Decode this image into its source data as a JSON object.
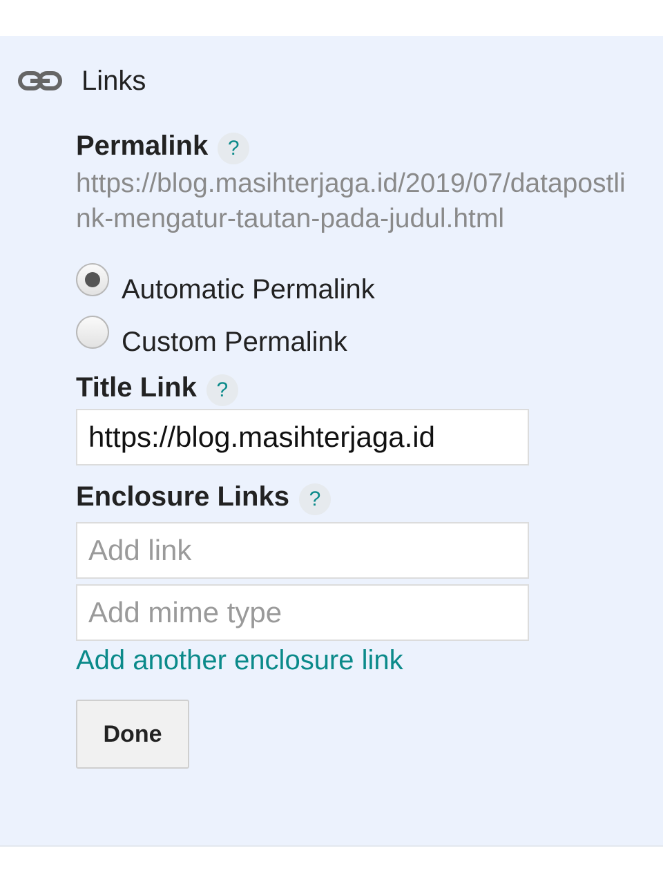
{
  "section": {
    "title": "Links",
    "icon": "link-icon"
  },
  "permalink": {
    "label": "Permalink",
    "help": "?",
    "url": "https://blog.masihterjaga.id/2019/07/datapostlink-mengatur-tautan-pada-judul.html",
    "options": [
      {
        "label": "Automatic Permalink",
        "selected": true
      },
      {
        "label": "Custom Permalink",
        "selected": false
      }
    ]
  },
  "title_link": {
    "label": "Title Link",
    "help": "?",
    "value": "https://blog.masihterjaga.id"
  },
  "enclosure": {
    "label": "Enclosure Links",
    "help": "?",
    "link_placeholder": "Add link",
    "mime_placeholder": "Add mime type",
    "add_another": "Add another enclosure link"
  },
  "actions": {
    "done_label": "Done"
  },
  "colors": {
    "panel_bg": "#ecf2fd",
    "accent": "#0b8a8a",
    "muted_text": "#8a8a8a"
  }
}
